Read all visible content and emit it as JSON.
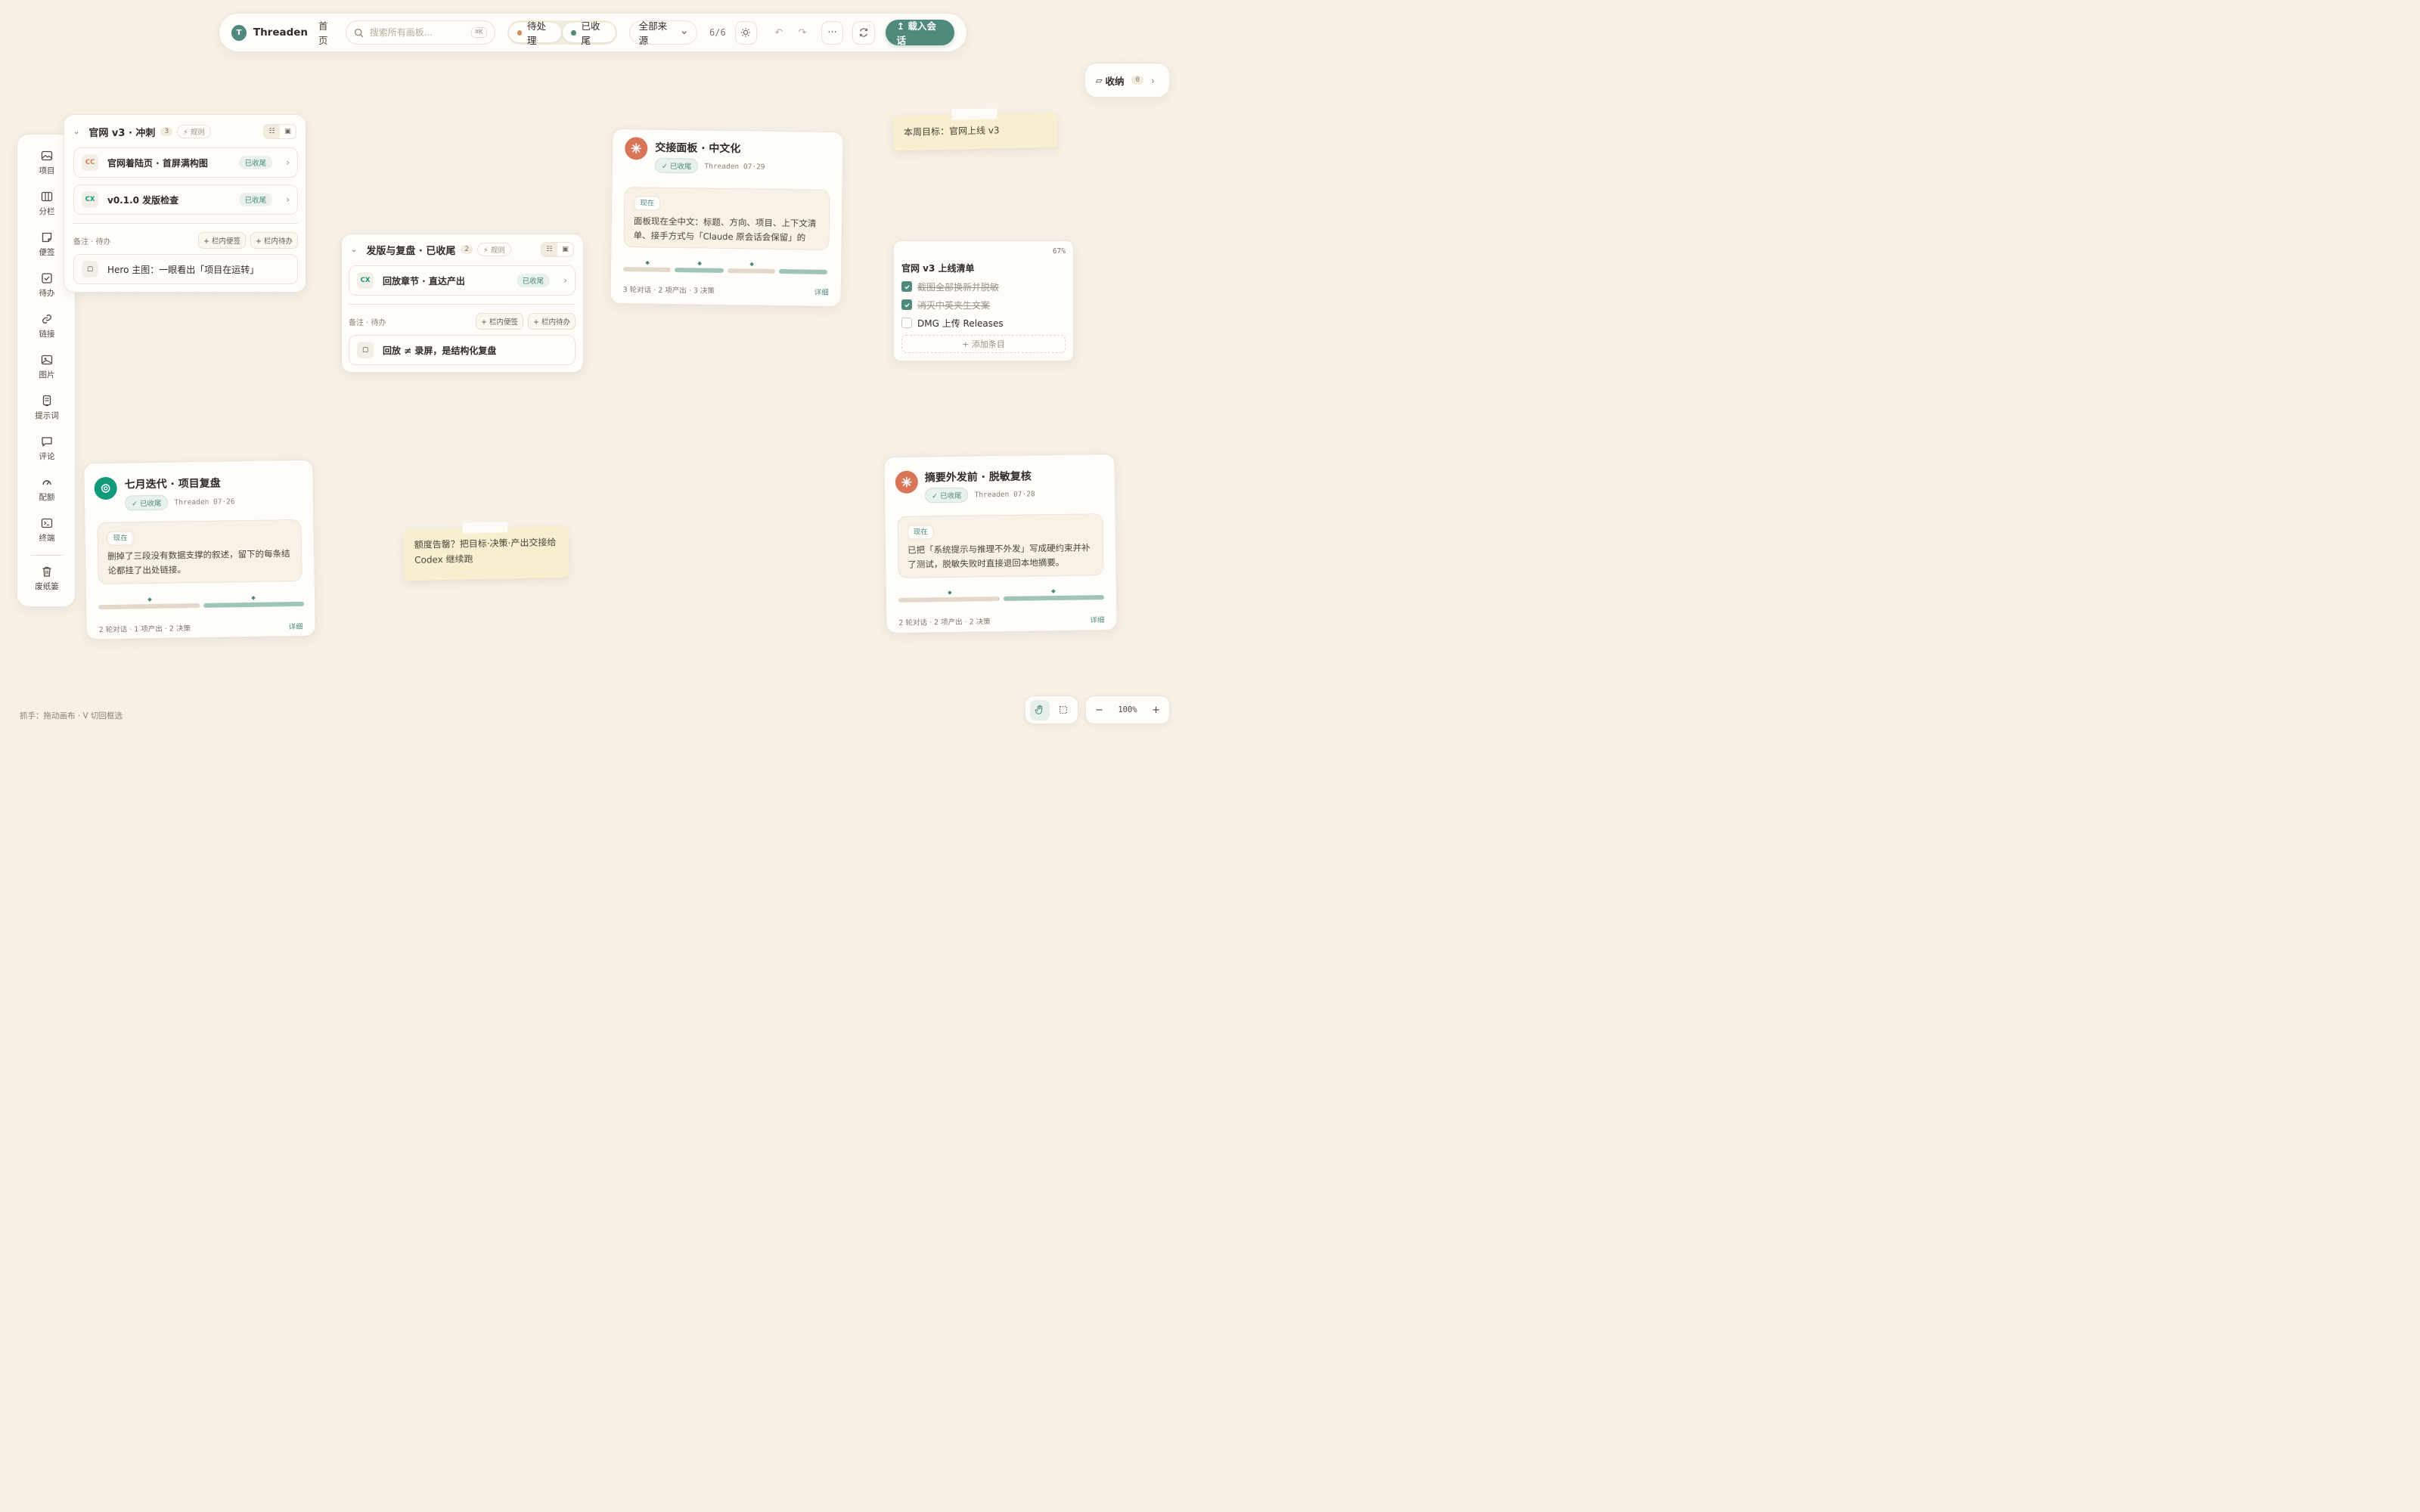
{
  "topbar": {
    "logo_letter": "T",
    "brand": "Threaden",
    "home": "首页",
    "search_placeholder": "搜索所有画板...",
    "search_shortcut": "⌘K",
    "filter_pending": "待处理",
    "filter_done": "已收尾",
    "source": "全部来源",
    "count": "6/6",
    "load": "↥ 载入会话",
    "colors": {
      "pending": "#d08a5c",
      "done": "#4f8a7c"
    }
  },
  "inbox": {
    "label": "收纳",
    "count": "0"
  },
  "sidebar": {
    "items": [
      {
        "label": "项目",
        "icon": "image-icon"
      },
      {
        "label": "分栏",
        "icon": "columns-icon"
      },
      {
        "label": "便签",
        "icon": "note-icon"
      },
      {
        "label": "待办",
        "icon": "checkbox-icon"
      },
      {
        "label": "链接",
        "icon": "link-icon"
      },
      {
        "label": "图片",
        "icon": "picture-icon"
      },
      {
        "label": "提示词",
        "icon": "prompt-icon"
      },
      {
        "label": "评论",
        "icon": "comment-icon"
      },
      {
        "label": "配额",
        "icon": "gauge-icon"
      },
      {
        "label": "终端",
        "icon": "terminal-icon"
      }
    ],
    "trash": "废纸篓"
  },
  "col1": {
    "title": "官网 v3 · 冲刺",
    "count": "3",
    "rule": "⚡ 规则",
    "rows": [
      {
        "tag": "CC",
        "title": "官网着陆页 · 首屏满构图",
        "status": "已收尾"
      },
      {
        "tag": "CX",
        "title": "v0.1.0 发版检查",
        "status": "已收尾"
      }
    ],
    "notes_label": "备注 · 待办",
    "add_note": "+ 栏内便签",
    "add_todo": "+ 栏内待办",
    "note": "Hero 主图：一眼看出「项目在运转」"
  },
  "col2": {
    "title": "发版与复盘 · 已收尾",
    "count": "2",
    "rule": "⚡ 规则",
    "rows": [
      {
        "tag": "CX",
        "title": "回放章节 · 直达产出",
        "status": "已收尾"
      }
    ],
    "notes_label": "备注 · 待办",
    "add_note": "+ 栏内便签",
    "add_todo": "+ 栏内待办",
    "note": "回放 ≠ 录屏，是结构化复盘"
  },
  "sess1": {
    "title": "交接面板 · 中文化",
    "status": "✓ 已收尾",
    "meta": "Threaden  07·29",
    "now": "现在",
    "text": "面板现在全中文：标题、方向、项目、上下文清单、接手方式与「Claude 原会话会保留」的提...",
    "stats": "3 轮对话  ·  2 项产出  ·  3 决策",
    "detail": "详细"
  },
  "sess2": {
    "title": "七月迭代 · 项目复盘",
    "status": "✓ 已收尾",
    "meta": "Threaden  07·26",
    "now": "现在",
    "text": "删掉了三段没有数据支撑的叙述，留下的每条结论都挂了出处链接。",
    "stats": "2 轮对话  ·  1 项产出  ·  2 决策",
    "detail": "详细"
  },
  "sess3": {
    "title": "摘要外发前 · 脱敏复核",
    "status": "✓ 已收尾",
    "meta": "Threaden  07·28",
    "now": "现在",
    "text": "已把「系统提示与推理不外发」写成硬约束并补了测试，脱敏失败时直接退回本地摘要。",
    "stats": "2 轮对话  ·  2 项产出  ·  2 决策",
    "detail": "详细"
  },
  "sticky1": {
    "text": "本周目标：官网上线 v3"
  },
  "sticky2": {
    "text": "额度告罄？把目标·决策·产出交接给 Codex 继续跑"
  },
  "checklist": {
    "percent": "67%",
    "progress": 0.67,
    "title": "官网 v3 上线清单",
    "items": [
      {
        "text": "截图全部换新并脱敏",
        "done": true
      },
      {
        "text": "消灭中英夹生文案",
        "done": true
      },
      {
        "text": "DMG 上传 Releases",
        "done": false
      }
    ],
    "add": "+ 添加条目"
  },
  "hint": "抓手：拖动画布 · V 切回框选",
  "zoom": {
    "level": "100%",
    "minus": "−",
    "plus": "+"
  }
}
